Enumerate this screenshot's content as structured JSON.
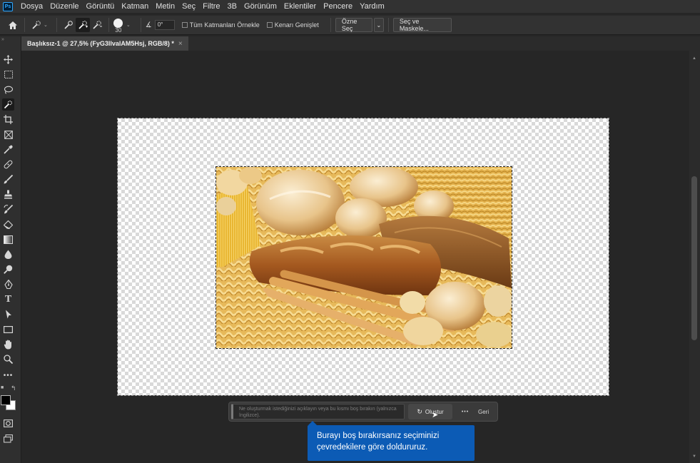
{
  "app": {
    "logo": "Ps"
  },
  "menu": [
    "Dosya",
    "Düzenle",
    "Görüntü",
    "Katman",
    "Metin",
    "Seç",
    "Filtre",
    "3B",
    "Görünüm",
    "Eklentiler",
    "Pencere",
    "Yardım"
  ],
  "options": {
    "brush_size": "30",
    "angle": "0°",
    "sample_all_layers": "Tüm Katmanları Örnekle",
    "enhance_edge": "Kenarı Genişlet",
    "select_subject": "Özne Seç",
    "select_and_mask": "Seç ve Maskele..."
  },
  "tab": {
    "title": "Başlıksız-1 @ 27,5% (FyG3IlvalAM5Hsj, RGB/8) *",
    "close": "×"
  },
  "taskbar": {
    "prompt_placeholder": "Ne oluşturmak istediğinizi açıklayın veya bu kısmı boş bırakın (yalnızca İngilizce).",
    "generate_label": "Oluştur",
    "more_label": "•••",
    "back_label": "Geri"
  },
  "tooltip": {
    "text": "Burayı boş bırakırsanız seçiminizi çevredekilere göre doldururuz."
  },
  "colors": {
    "foreground": "#000000",
    "background": "#ffffff",
    "tooltip_bg": "#0c5bb5"
  }
}
